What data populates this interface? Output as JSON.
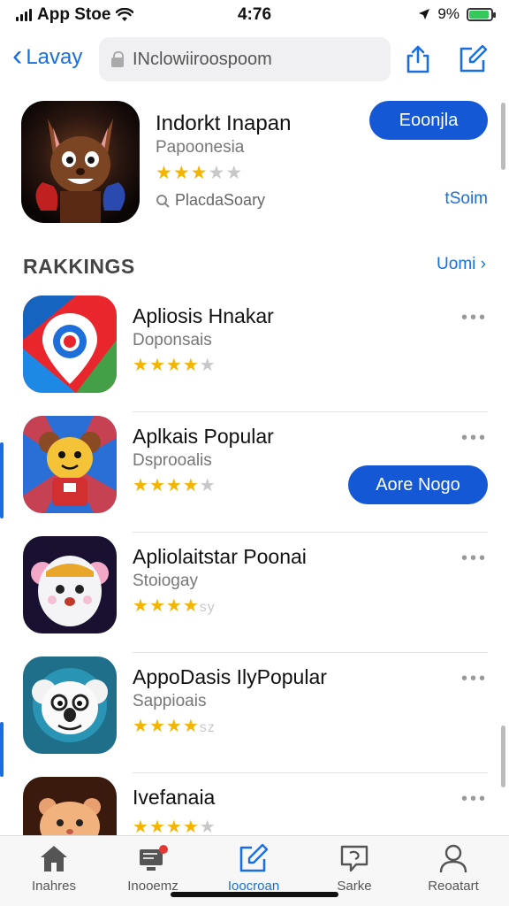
{
  "status_bar": {
    "carrier": "App Stoe",
    "time": "4:76",
    "battery_pct": "9%",
    "battery_level": 0.9
  },
  "nav": {
    "back_label": "Lavay",
    "search_value": "INclowiiroospoom"
  },
  "featured": {
    "title": "Indorkt Inapan",
    "subtitle": "Papoonesia",
    "rating": 3,
    "meta": "PlacdaSoary",
    "size_link": "tSoim",
    "button_label": "Eoonjla"
  },
  "section": {
    "heading": "RAKKINGS",
    "see_all": "Uomi"
  },
  "apps": [
    {
      "title": "Apliosis Hnakar",
      "subtitle": "Doponsais",
      "rating": 4,
      "star_tail": ""
    },
    {
      "title": "Aplkais Popular",
      "subtitle": "Dsprooalis",
      "rating": 4,
      "star_tail": "",
      "button_label": "Aore Nogo"
    },
    {
      "title": "Apliolaitstar Poonai",
      "subtitle": "Stoiogay",
      "rating": 4,
      "star_tail": "sy"
    },
    {
      "title": "AppoDasis IlyPopular",
      "subtitle": "Sappioais",
      "rating": 4,
      "star_tail": "sz"
    },
    {
      "title": "Ivefanaia",
      "subtitle": "",
      "rating": 4,
      "star_tail": ""
    }
  ],
  "tabs": [
    {
      "label": "Inahres",
      "icon": "house-icon"
    },
    {
      "label": "Inooemz",
      "icon": "monitor-badge-icon"
    },
    {
      "label": "Ioocroan",
      "icon": "pencil-square-icon"
    },
    {
      "label": "Sarke",
      "icon": "speech-bubble-icon"
    },
    {
      "label": "Reoatart",
      "icon": "person-icon"
    }
  ],
  "colors": {
    "accent": "#1558d6",
    "star": "#f5b400"
  }
}
